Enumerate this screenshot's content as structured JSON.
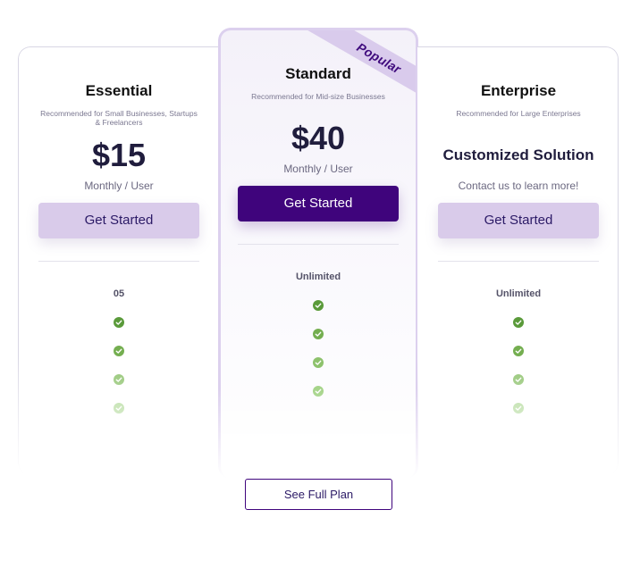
{
  "plans": [
    {
      "name": "Essential",
      "description": "Recommended for Small Businesses, Startups & Freelancers",
      "price": "$15",
      "price_note": "Monthly / User",
      "cta_label": "Get Started",
      "feature_value": "05",
      "check_count": 4
    },
    {
      "name": "Standard",
      "description": "Recommended for Mid-size Businesses",
      "price": "$40",
      "price_note": "Monthly / User",
      "cta_label": "Get Started",
      "feature_value": "Unlimited",
      "check_count": 4,
      "ribbon": "Popular"
    },
    {
      "name": "Enterprise",
      "description": "Recommended for Large Enterprises",
      "price": "Customized Solution",
      "price_note": "Contact us to learn more!",
      "cta_label": "Get Started",
      "feature_value": "Unlimited",
      "check_count": 4
    }
  ],
  "footer": {
    "see_plan_label": "See Full Plan"
  },
  "colors": {
    "brand_dark": "#3f047c",
    "brand_light": "#d9cbea",
    "check_green_dark": "#5a9a3a",
    "check_green_light": "#a6d48a"
  },
  "icons": {
    "check": "check-circle-icon"
  }
}
